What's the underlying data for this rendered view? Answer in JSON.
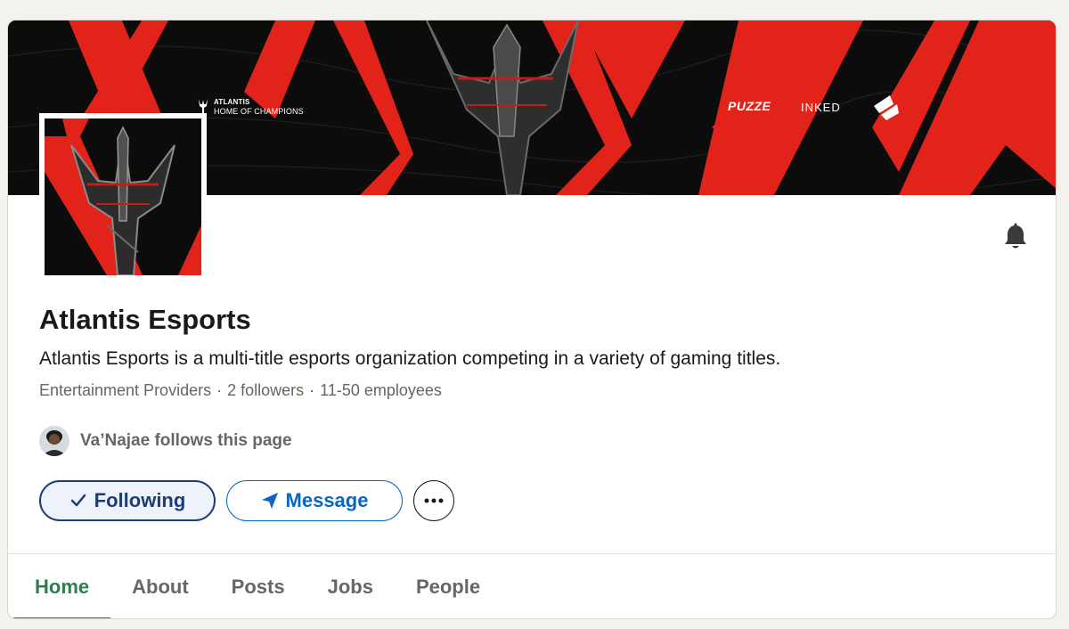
{
  "banner": {
    "tag_line1": "ATLANTIS",
    "tag_line2": "HOME OF CHAMPIONS",
    "sponsor1": "PUZZE",
    "sponsor2": "INKED"
  },
  "company": {
    "name": "Atlantis Esports",
    "tagline": "Atlantis Esports is a multi-title esports organization competing in a variety of gaming titles.",
    "industry": "Entertainment Providers",
    "followers": "2 followers",
    "employees": "11-50 employees"
  },
  "connections": {
    "text": "Va’Najae follows this page"
  },
  "actions": {
    "following_label": "Following",
    "message_label": "Message"
  },
  "tabs": [
    {
      "label": "Home"
    },
    {
      "label": "About"
    },
    {
      "label": "Posts"
    },
    {
      "label": "Jobs"
    },
    {
      "label": "People"
    }
  ],
  "colors": {
    "brand_red": "#e2231a",
    "active_tab": "#2e7d4f",
    "following_navy": "#1d3d73",
    "message_blue": "#0a66c2"
  },
  "icons": {
    "bell": "bell-icon",
    "check": "check-icon",
    "send": "send-icon",
    "more": "more-horizontal-icon"
  }
}
